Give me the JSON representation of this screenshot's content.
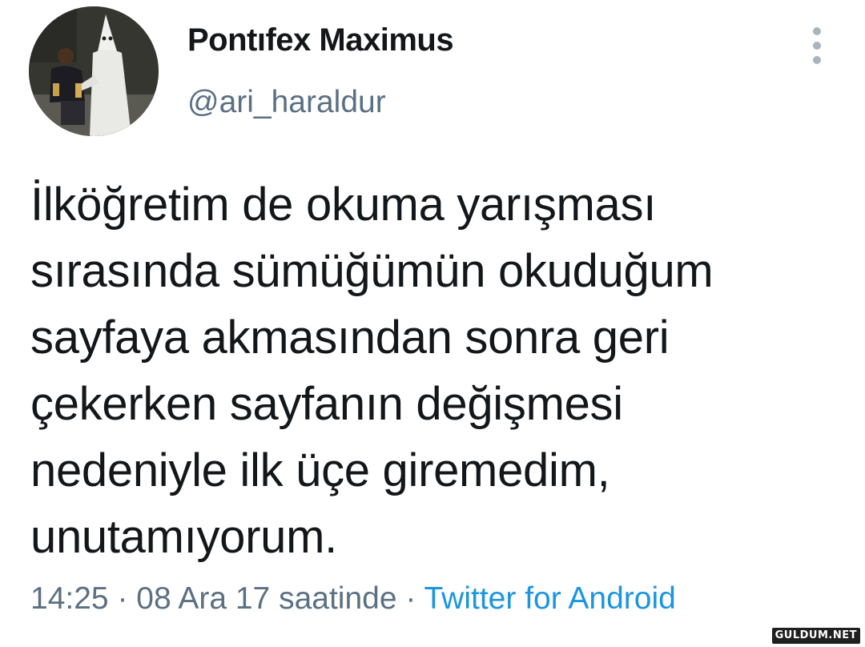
{
  "author": {
    "display_name": "Pontıfex Maximus",
    "handle": "@ari_haraldur",
    "avatar_icon": "profile-photo"
  },
  "menu": {
    "icon": "more-vertical-icon"
  },
  "tweet": {
    "lines": [
      "İlköğretim de okuma yarışması",
      "sırasında sümüğümün okuduğum",
      "sayfaya akmasından sonra geri",
      "çekerken sayfanın değişmesi",
      "nedeniyle ilk üçe giremedim,",
      "unutamıyorum."
    ]
  },
  "meta": {
    "time": "14:25",
    "separator": " · ",
    "date": "08 Ara 17 saatinde",
    "source": "Twitter for Android"
  },
  "watermark": "GULDUM.NET",
  "colors": {
    "text": "#14171a",
    "secondary": "#5b7083",
    "link": "#1b95e0"
  }
}
